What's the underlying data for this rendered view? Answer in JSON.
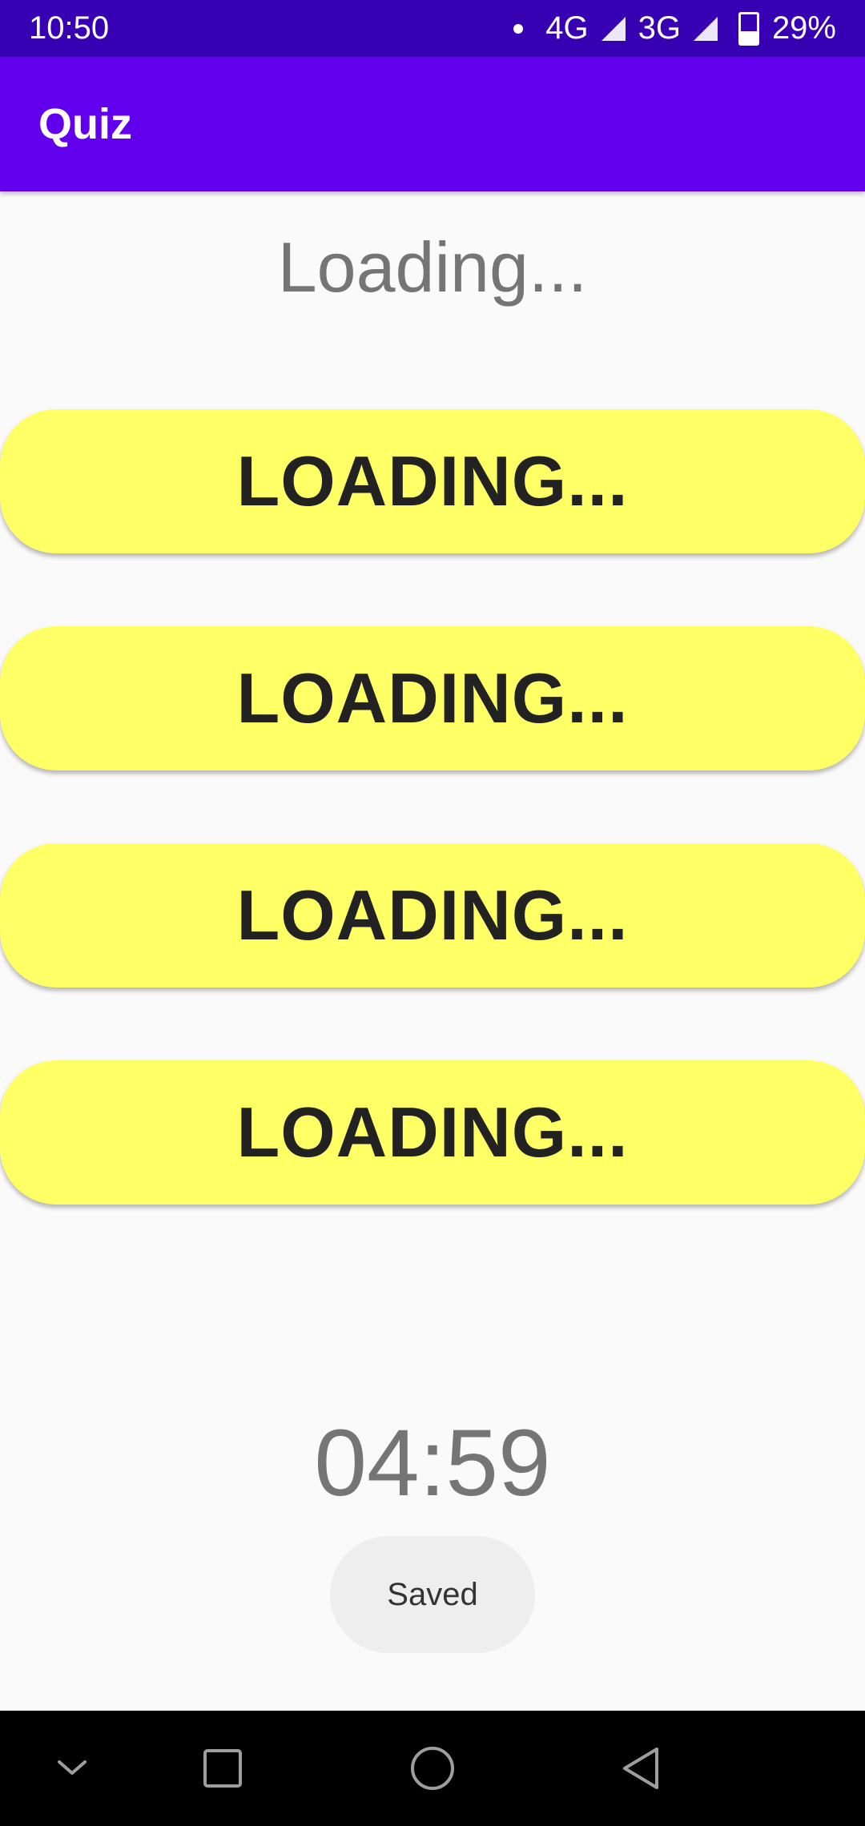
{
  "status_bar": {
    "time": "10:50",
    "network_1": "4G",
    "network_2": "3G",
    "battery": "29%"
  },
  "app_bar": {
    "title": "Quiz"
  },
  "quiz": {
    "question": "Loading...",
    "answers": [
      {
        "label": "LOADING..."
      },
      {
        "label": "LOADING..."
      },
      {
        "label": "LOADING..."
      },
      {
        "label": "LOADING..."
      }
    ],
    "answer_color": "#ffff66",
    "timer": "04:59"
  },
  "toast": {
    "message": "Saved"
  },
  "nav_bar": {
    "buttons": [
      "chevron-down-icon",
      "recents-icon",
      "home-icon",
      "back-icon"
    ]
  },
  "colors": {
    "status_bar": "#3700b3",
    "app_bar": "#6200ee",
    "background": "#fafafa"
  }
}
